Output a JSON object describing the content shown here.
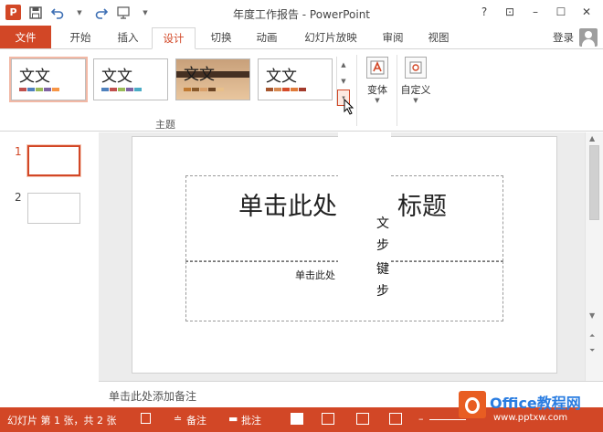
{
  "window": {
    "title": "年度工作报告 - PowerPoint",
    "controls": [
      "?",
      "⊡",
      "–",
      "☐",
      "✕"
    ]
  },
  "tabs": [
    {
      "label": "文件"
    },
    {
      "label": "开始"
    },
    {
      "label": "插入"
    },
    {
      "label": "设计"
    },
    {
      "label": "切换"
    },
    {
      "label": "动画"
    },
    {
      "label": "幻灯片放映"
    },
    {
      "label": "审阅"
    },
    {
      "label": "视图"
    }
  ],
  "active_tab": "设计",
  "account": {
    "login_label": "登录"
  },
  "ribbon": {
    "themes": [
      {
        "label": "文文",
        "colors": [
          "#c0504d",
          "#4f81bd",
          "#9bbb59",
          "#8064a2",
          "#f79646"
        ]
      },
      {
        "label": "文文",
        "colors": [
          "#4f81bd",
          "#c0504d",
          "#9bbb59",
          "#8064a2",
          "#4bacc6"
        ]
      },
      {
        "label": "文文",
        "colors": [
          "#c07a32",
          "#8a5a2b",
          "#d9a06a",
          "#6b4423",
          "#e8c08a"
        ]
      },
      {
        "label": "文文",
        "colors": [
          "#a6562e",
          "#d78a52",
          "#d54c2a",
          "#e07b39",
          "#a33a2b"
        ]
      }
    ],
    "group_label": "主题",
    "variants_label": "变体",
    "customize_label": "自定义"
  },
  "thumbnails": [
    {
      "number": "1"
    },
    {
      "number": "2"
    }
  ],
  "slide": {
    "title_left": "单击此处",
    "title_right": "标题",
    "subtitle_left": "单击此处",
    "overlay_chars": [
      "文",
      "步",
      "键",
      "步"
    ]
  },
  "notes": {
    "placeholder": "单击此处添加备注"
  },
  "statusbar": {
    "slide_info": "幻灯片 第 1 张，共 2 张",
    "notes_label": "备注",
    "comments_label": "批注"
  },
  "watermark": {
    "brand": "Office教程网",
    "url": "www.pptxw.com"
  },
  "colors": {
    "accent": "#d24726"
  }
}
